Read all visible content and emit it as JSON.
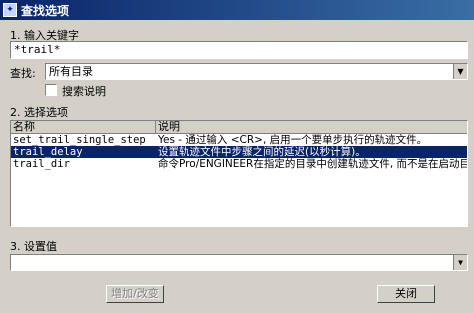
{
  "window": {
    "title": "查找选项"
  },
  "section1": {
    "label": "1.  输入关键字"
  },
  "keyword": {
    "value": "*trail*"
  },
  "find": {
    "label": "查找:",
    "selected": "所有目录"
  },
  "search_desc": {
    "label": "搜索说明",
    "checked": false
  },
  "section2": {
    "label": "2.  选择选项"
  },
  "table": {
    "headers": [
      "名称",
      "说明"
    ],
    "rows": [
      {
        "name": "set_trail_single_step",
        "desc": "Yes - 通过输入 <CR>, 启用一个要单步执行的轨迹文件。"
      },
      {
        "name": "trail_delay",
        "desc": "设置轨迹文件中步骤之间的延迟(以秒计算)。",
        "selected": true
      },
      {
        "name": "trail_dir",
        "desc": "命令Pro/ENGINEER在指定的目录中创建轨迹文件, 而不是在启动目录"
      }
    ]
  },
  "section3": {
    "label": "3.  设置值"
  },
  "value_field": {
    "value": ""
  },
  "buttons": {
    "add_change": "增加/改变",
    "close": "关闭"
  }
}
